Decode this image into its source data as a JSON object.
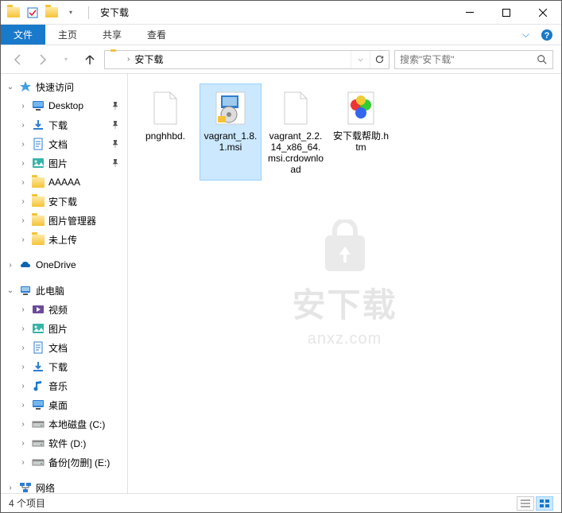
{
  "window": {
    "title": "安下载"
  },
  "ribbon": {
    "tabs": [
      "文件",
      "主页",
      "共享",
      "查看"
    ],
    "activeIndex": 0
  },
  "address": {
    "crumb": "安下载"
  },
  "search": {
    "placeholder": "搜索\"安下载\""
  },
  "sidebar": {
    "quickAccess": "快速访问",
    "quickItems": [
      {
        "label": "Desktop",
        "pinned": true,
        "icon": "desktop"
      },
      {
        "label": "下载",
        "pinned": true,
        "icon": "downloads"
      },
      {
        "label": "文档",
        "pinned": true,
        "icon": "documents"
      },
      {
        "label": "图片",
        "pinned": true,
        "icon": "pictures"
      },
      {
        "label": "AAAAA",
        "pinned": false,
        "icon": "folder"
      },
      {
        "label": "安下载",
        "pinned": false,
        "icon": "folder"
      },
      {
        "label": "图片管理器",
        "pinned": false,
        "icon": "folder"
      },
      {
        "label": "未上传",
        "pinned": false,
        "icon": "folder"
      }
    ],
    "onedrive": "OneDrive",
    "thisPC": "此电脑",
    "pcItems": [
      {
        "label": "视频",
        "icon": "videos"
      },
      {
        "label": "图片",
        "icon": "pictures"
      },
      {
        "label": "文档",
        "icon": "documents"
      },
      {
        "label": "下载",
        "icon": "downloads"
      },
      {
        "label": "音乐",
        "icon": "music"
      },
      {
        "label": "桌面",
        "icon": "desktop"
      },
      {
        "label": "本地磁盘 (C:)",
        "icon": "drive"
      },
      {
        "label": "软件 (D:)",
        "icon": "drive"
      },
      {
        "label": "备份[勿删] (E:)",
        "icon": "drive"
      }
    ],
    "network": "网络"
  },
  "files": [
    {
      "name": "pnghhbd.",
      "type": "blank",
      "selected": false
    },
    {
      "name": "vagrant_1.8.1.msi",
      "type": "msi",
      "selected": true
    },
    {
      "name": "vagrant_2.2.14_x86_64.msi.crdownload",
      "type": "blank",
      "selected": false
    },
    {
      "name": "安下载帮助.htm",
      "type": "htm",
      "selected": false
    }
  ],
  "watermark": {
    "main": "安下载",
    "sub": "anxz.com"
  },
  "status": {
    "text": "4 个项目"
  }
}
